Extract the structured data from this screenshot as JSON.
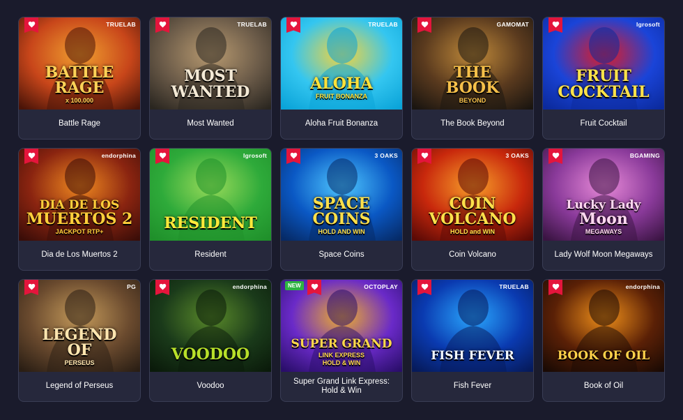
{
  "games": [
    {
      "title": "Battle Rage",
      "provider": "TRUELAB",
      "art_lines": [
        "BATTLE",
        "RAGE",
        "x 100.000"
      ],
      "colors": [
        "#4a1408",
        "#c8461a",
        "#f0a030"
      ],
      "art_fg": "#ffd257"
    },
    {
      "title": "Most Wanted",
      "provider": "TRUELAB",
      "art_lines": [
        "MOST",
        "WANTED"
      ],
      "colors": [
        "#2a2620",
        "#6a5a48",
        "#b89a70"
      ],
      "art_fg": "#f4ead6"
    },
    {
      "title": "Aloha Fruit Bonanza",
      "provider": "TRUELAB",
      "art_lines": [
        "ALOHA",
        "FRUIT BONANZA"
      ],
      "colors": [
        "#0aa3d8",
        "#34c6f0",
        "#f7d43a"
      ],
      "art_fg": "#ffe23a"
    },
    {
      "title": "The Book Beyond",
      "provider": "GAMOMAT",
      "art_lines": [
        "THE",
        "BOOK",
        "BEYOND"
      ],
      "colors": [
        "#1a1510",
        "#5a3a1e",
        "#c08a3a"
      ],
      "art_fg": "#f6c04a"
    },
    {
      "title": "Fruit Cocktail",
      "provider": "Igrosoft",
      "art_lines": [
        "FRUIT",
        "COCKTAIL"
      ],
      "colors": [
        "#0b2a9c",
        "#1a44d8",
        "#e31b23"
      ],
      "art_fg": "#ffe34a"
    },
    {
      "title": "Dia de Los Muertos 2",
      "provider": "endorphina",
      "art_lines": [
        "DIA DE LOS",
        "MUERTOS 2",
        "JACKPOT RTP+"
      ],
      "colors": [
        "#3a0d08",
        "#8a2410",
        "#f08a20"
      ],
      "art_fg": "#ffcf3a"
    },
    {
      "title": "Resident",
      "provider": "Igrosoft",
      "art_lines": [
        "RESIDENT"
      ],
      "colors": [
        "#1f8f2a",
        "#2eaa3a",
        "#9adb5a"
      ],
      "art_fg": "#ffea3a"
    },
    {
      "title": "Space Coins",
      "provider": "3 OAKS",
      "art_lines": [
        "SPACE",
        "COINS",
        "HOLD AND WIN"
      ],
      "colors": [
        "#062a66",
        "#0a58c4",
        "#4fc8ff"
      ],
      "art_fg": "#ffe04a"
    },
    {
      "title": "Coin Volcano",
      "provider": "3 OAKS",
      "art_lines": [
        "COIN",
        "VOLCANO",
        "HOLD and WIN"
      ],
      "colors": [
        "#5a0a06",
        "#c8280c",
        "#f8a02a"
      ],
      "art_fg": "#ffe04a"
    },
    {
      "title": "Lady Wolf Moon Megaways",
      "provider": "BGAMING",
      "art_lines": [
        "Lucky Lady",
        "Moon",
        "MEGAWAYS"
      ],
      "colors": [
        "#3a1442",
        "#8a3a9a",
        "#e88ad8"
      ],
      "art_fg": "#ffd8f0"
    },
    {
      "title": "Legend of Perseus",
      "provider": "PG",
      "art_lines": [
        "LEGEND",
        "OF",
        "PERSEUS"
      ],
      "colors": [
        "#2a1e14",
        "#6a4a2e",
        "#c49a5a"
      ],
      "art_fg": "#ffe6b0"
    },
    {
      "title": "Voodoo",
      "provider": "endorphina",
      "art_lines": [
        "VOODOO"
      ],
      "colors": [
        "#0a1a0a",
        "#1a3a1a",
        "#5a8a2a"
      ],
      "art_fg": "#b8e02a"
    },
    {
      "title": "Super Grand Link Express: Hold & Win",
      "provider": "OCTOPLAY",
      "badge": "NEW",
      "art_lines": [
        "SUPER GRAND",
        "LINK EXPRESS",
        "HOLD & WIN"
      ],
      "colors": [
        "#2a0e6a",
        "#6a2ac8",
        "#f0b02a"
      ],
      "art_fg": "#ffd84a"
    },
    {
      "title": "Fish Fever",
      "provider": "TRUELAB",
      "art_lines": [
        "FISH FEVER"
      ],
      "colors": [
        "#061a5a",
        "#0a3ab0",
        "#2aa8ff"
      ],
      "art_fg": "#f4f8ff"
    },
    {
      "title": "Book of Oil",
      "provider": "endorphina",
      "art_lines": [
        "BOOK OF OIL"
      ],
      "colors": [
        "#1a0a04",
        "#5a2006",
        "#f0901a"
      ],
      "art_fg": "#ffd24a"
    }
  ]
}
